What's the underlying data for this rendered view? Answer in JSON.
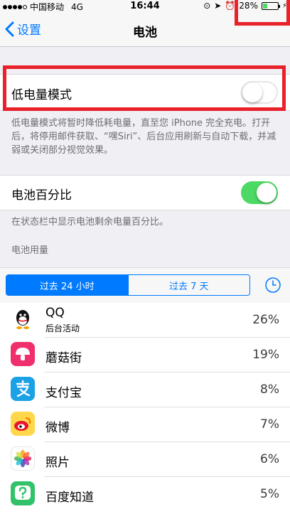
{
  "status_bar": {
    "carrier": "中国移动",
    "network": "4G",
    "time": "16:44",
    "battery_percent_text": "28%",
    "battery_level": 0.28
  },
  "nav": {
    "back_label": "设置",
    "title": "电池"
  },
  "low_power": {
    "label": "低电量模式",
    "on": false,
    "footer": "低电量模式将暂时降低耗电量，直至您 iPhone 完全充电。打开后，将停用邮件获取、“嘿Siri”、后台应用刷新与自动下载，并减弱或关闭部分视觉效果。"
  },
  "battery_percentage": {
    "label": "电池百分比",
    "on": true,
    "footer": "在状态栏中显示电池剩余电量百分比。"
  },
  "usage": {
    "section_header": "电池用量",
    "segments": [
      "过去 24 小时",
      "过去 7 天"
    ],
    "selected_segment": 0
  },
  "apps": [
    {
      "name": "QQ",
      "subtitle": "后台活动",
      "percent": "26%"
    },
    {
      "name": "蘑菇街",
      "subtitle": "",
      "percent": "19%"
    },
    {
      "name": "支付宝",
      "subtitle": "",
      "percent": "8%"
    },
    {
      "name": "微博",
      "subtitle": "",
      "percent": "7%"
    },
    {
      "name": "照片",
      "subtitle": "",
      "percent": "6%"
    },
    {
      "name": "百度知道",
      "subtitle": "",
      "percent": "5%"
    }
  ],
  "colors": {
    "ios_blue": "#007aff",
    "switch_green": "#4cd964",
    "highlight_red": "#e8212b"
  }
}
